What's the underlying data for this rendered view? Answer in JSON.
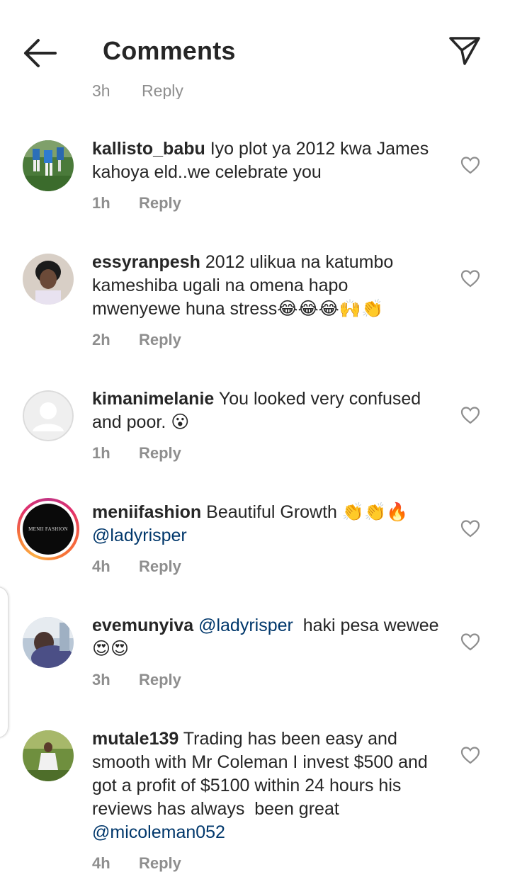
{
  "header": {
    "title": "Comments",
    "back_icon": "arrow-left-icon",
    "share_icon": "paper-plane-icon"
  },
  "clipped_row": {
    "time": "3h",
    "reply": "Reply"
  },
  "colors": {
    "text": "#262626",
    "muted": "#8e8e8e",
    "mention": "#00376b"
  },
  "comments": [
    {
      "username": "kallisto_babu",
      "text": "Iyo plot ya 2012 kwa James kahoya eld..we celebrate you",
      "time": "1h",
      "reply": "Reply",
      "avatar": "soccer-photo"
    },
    {
      "username": "essyranpesh",
      "text": "2012 ulikua na katumbo kameshiba ugali na omena hapo mwenyewe huna stress😂😂😂🙌👏",
      "time": "2h",
      "reply": "Reply",
      "avatar": "portrait-photo"
    },
    {
      "username": "kimanimelanie",
      "text": "You looked very confused and poor. 😮",
      "time": "1h",
      "reply": "Reply",
      "avatar": "default-avatar"
    },
    {
      "username": "meniifashion",
      "text": "Beautiful Growth 👏👏🔥",
      "mention": "@ladyrisper",
      "time": "4h",
      "reply": "Reply",
      "avatar": "menii-logo",
      "avatar_text": "MENII FASHION"
    },
    {
      "username": "evemunyiva",
      "mention": "@ladyrisper",
      "text": "  haki pesa wewee😍😍",
      "time": "3h",
      "reply": "Reply",
      "avatar": "person-photo"
    },
    {
      "username": "mutale139",
      "text": "Trading has been easy and smooth with Mr Coleman I invest $500 and got a profit of $5100 within 24 hours his reviews has always  been great ",
      "mention": "@micoleman052",
      "time": "4h",
      "reply": "Reply",
      "avatar": "outdoor-photo"
    }
  ]
}
